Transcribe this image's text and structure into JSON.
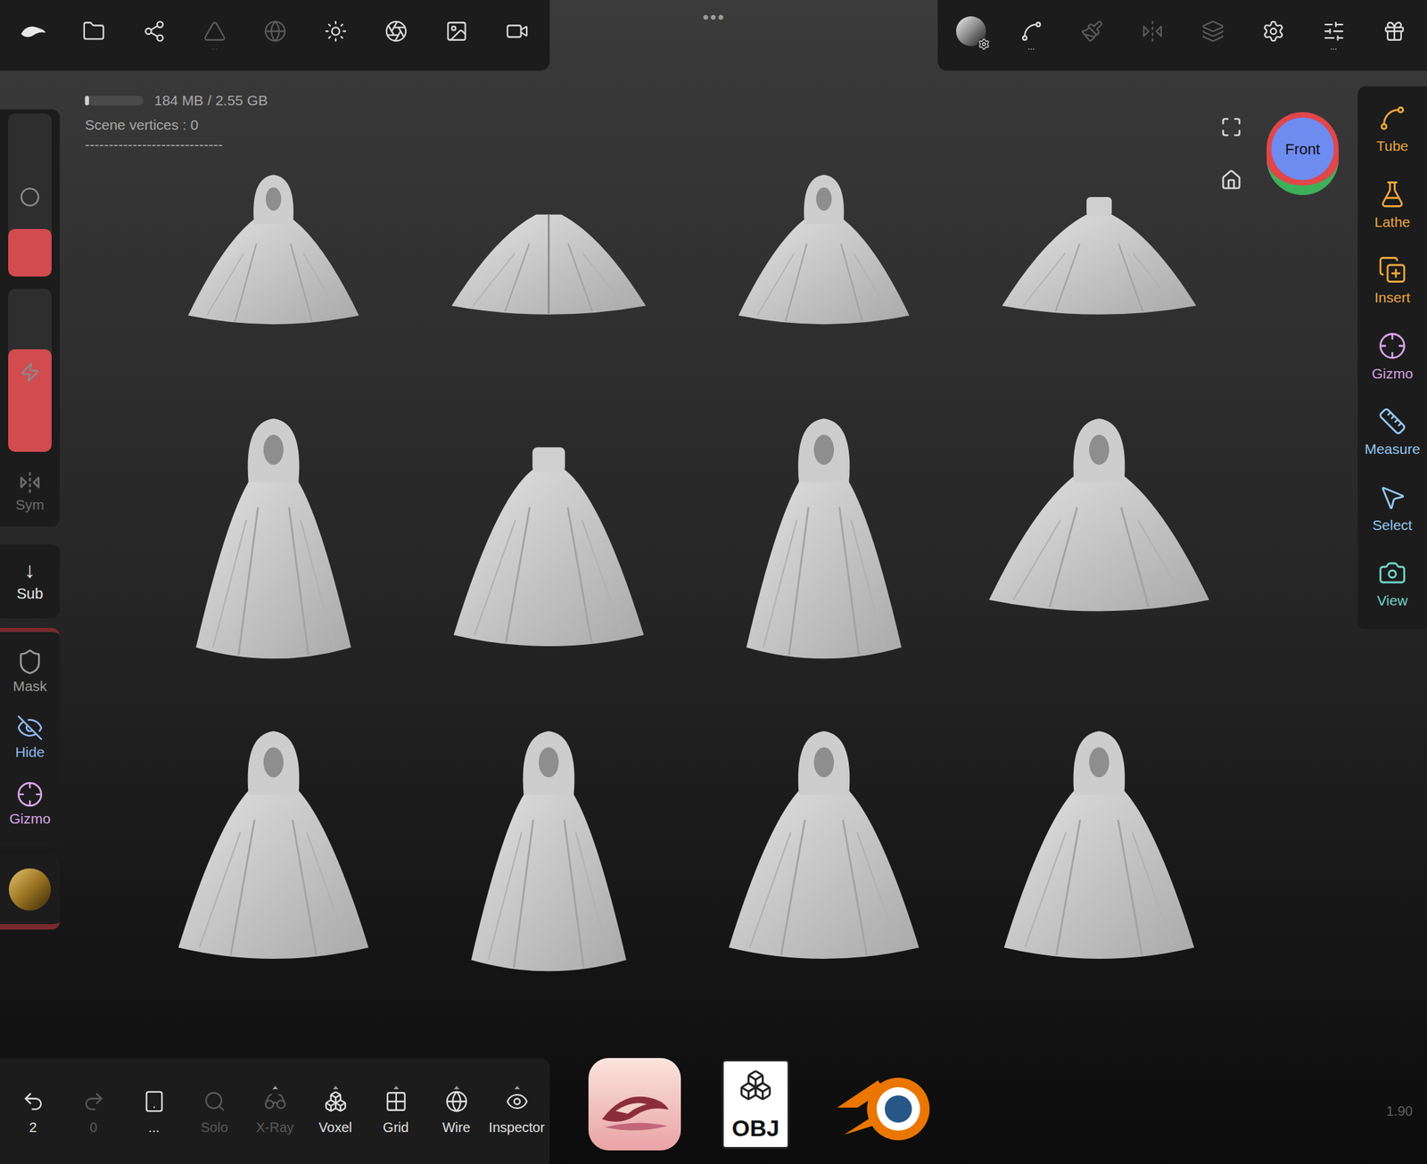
{
  "stats": {
    "memory": "184 MB / 2.55 GB",
    "vertices": "Scene vertices : 0",
    "separator": "-----------------------------"
  },
  "top_menu": "•••",
  "top_left_toolbar": [
    {
      "disabled": false,
      "more": ""
    },
    {
      "disabled": false,
      "more": ""
    },
    {
      "disabled": false,
      "more": ""
    },
    {
      "disabled": true,
      "more": "..."
    },
    {
      "disabled": true,
      "more": ""
    },
    {
      "disabled": false,
      "more": ""
    },
    {
      "disabled": false,
      "more": ""
    },
    {
      "disabled": false,
      "more": ""
    },
    {
      "disabled": false,
      "more": ""
    }
  ],
  "top_right_toolbar": [
    {
      "disabled": false,
      "more": ""
    },
    {
      "disabled": false,
      "more": "..."
    },
    {
      "disabled": true,
      "more": ""
    },
    {
      "disabled": true,
      "more": ""
    },
    {
      "disabled": true,
      "more": ""
    },
    {
      "disabled": false,
      "more": ""
    },
    {
      "disabled": false,
      "more": "..."
    },
    {
      "disabled": false,
      "more": ""
    }
  ],
  "left_sliders": [
    {
      "level": 0.29
    },
    {
      "level": 0.63
    }
  ],
  "left_tools": [
    {
      "label": "Sym",
      "color": "#6b6b6b"
    },
    {
      "label": "Sub",
      "color": "#e6e6e6"
    },
    {
      "label": "Mask",
      "color": "#9a9a9a"
    },
    {
      "label": "Hide",
      "color": "#8fb8f0"
    },
    {
      "label": "Gizmo",
      "color": "#d8a6e6"
    }
  ],
  "right_tools": [
    {
      "label": "Tube",
      "color": "#e9a63c"
    },
    {
      "label": "Lathe",
      "color": "#e9a63c"
    },
    {
      "label": "Insert",
      "color": "#e9a63c"
    },
    {
      "label": "Gizmo",
      "color": "#d6a4e2"
    },
    {
      "label": "Measure",
      "color": "#93c7f2"
    },
    {
      "label": "Select",
      "color": "#93c7f2"
    },
    {
      "label": "View",
      "color": "#6fd6c6"
    }
  ],
  "view_cube": {
    "label": "Front"
  },
  "bottom_toolbar": [
    {
      "label": "2",
      "disabled": false,
      "has_menu": false
    },
    {
      "label": "0",
      "disabled": true,
      "has_menu": false
    },
    {
      "label": "...",
      "disabled": false,
      "has_menu": false
    },
    {
      "label": "Solo",
      "disabled": true,
      "has_menu": false
    },
    {
      "label": "X-Ray",
      "disabled": true,
      "has_menu": true
    },
    {
      "label": "Voxel",
      "disabled": false,
      "has_menu": true
    },
    {
      "label": "Grid",
      "disabled": false,
      "has_menu": true
    },
    {
      "label": "Wire",
      "disabled": false,
      "has_menu": true
    },
    {
      "label": "Inspector",
      "disabled": false,
      "has_menu": true
    }
  ],
  "logos": {
    "obj": "OBJ"
  },
  "version": "1.90",
  "capes": [
    {
      "kind": "hooded",
      "shape": "bell"
    },
    {
      "kind": "open",
      "shape": "wide"
    },
    {
      "kind": "hooded",
      "shape": "bell"
    },
    {
      "kind": "collar",
      "shape": "wide"
    },
    {
      "kind": "hooded",
      "shape": "long"
    },
    {
      "kind": "collar",
      "shape": "poncho"
    },
    {
      "kind": "hooded",
      "shape": "long"
    },
    {
      "kind": "hooded",
      "shape": "bell"
    },
    {
      "kind": "hooded",
      "shape": "poncho"
    },
    {
      "kind": "hooded",
      "shape": "long"
    },
    {
      "kind": "hooded",
      "shape": "poncho"
    },
    {
      "kind": "hooded",
      "shape": "poncho"
    }
  ]
}
